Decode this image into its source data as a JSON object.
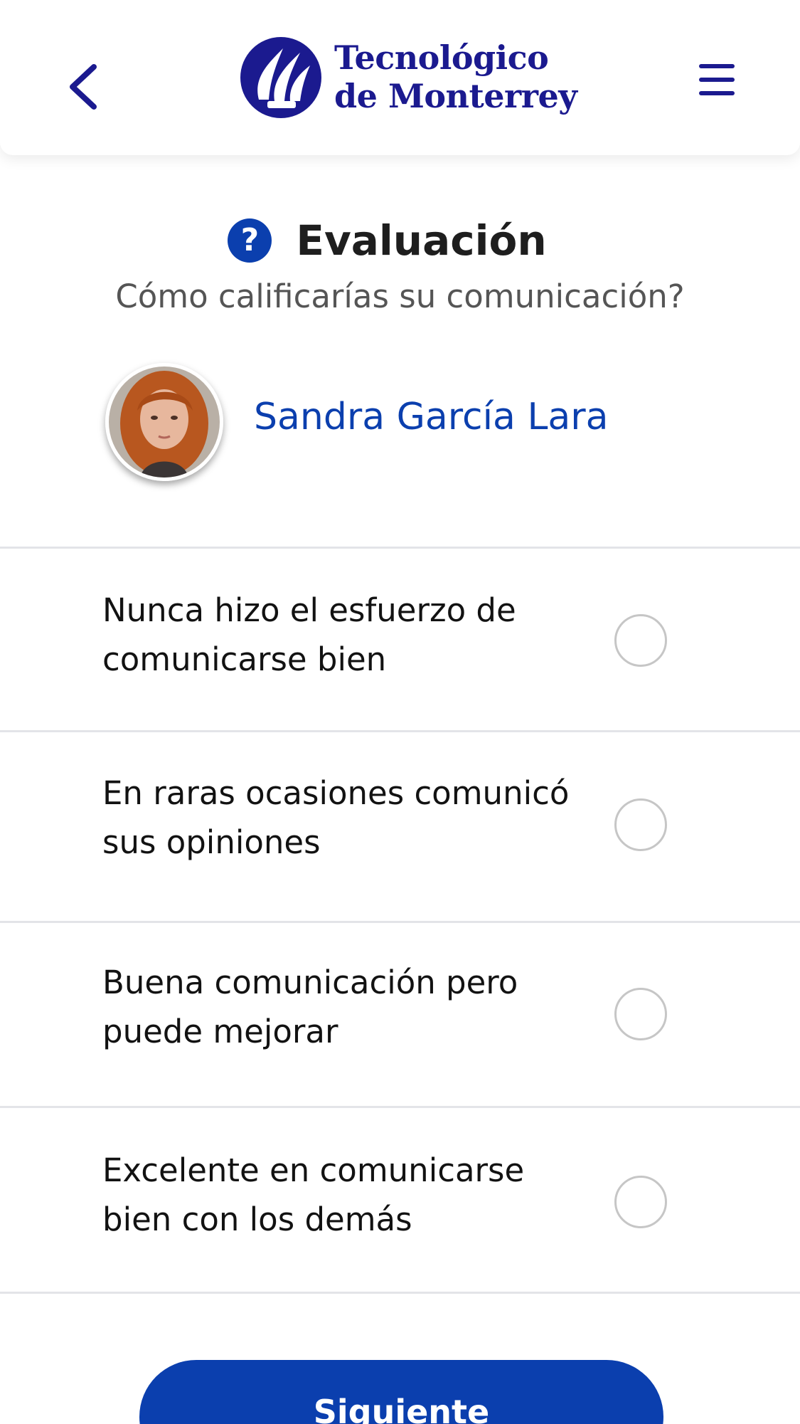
{
  "header": {
    "back_icon": "chevron-left-icon",
    "menu_icon": "hamburger-menu-icon",
    "logo": {
      "line1": "Tecnológico",
      "line2": "de Monterrey",
      "icon": "flame-logo-icon"
    }
  },
  "evaluation": {
    "icon": "question-circle-icon",
    "help_glyph": "?",
    "title": "Evaluación",
    "question": "Cómo calificarías su comunicación?"
  },
  "person": {
    "name": "Sandra García Lara",
    "avatar": "profile-photo"
  },
  "options": [
    {
      "label": "Nunca hizo el esfuerzo de comunicarse bien",
      "selected": false
    },
    {
      "label": "En raras ocasiones comunicó sus opiniones",
      "selected": false
    },
    {
      "label": "Buena comunicación pero puede mejorar",
      "selected": false
    },
    {
      "label": "Excelente en comunicarse bien con los demás",
      "selected": false
    }
  ],
  "actions": {
    "next_label": "Siguiente"
  },
  "colors": {
    "brand_blue": "#0b3fae",
    "logo_navy": "#1b1a8f",
    "divider": "#e3e4e8",
    "radio_border": "#c6c6c6"
  }
}
